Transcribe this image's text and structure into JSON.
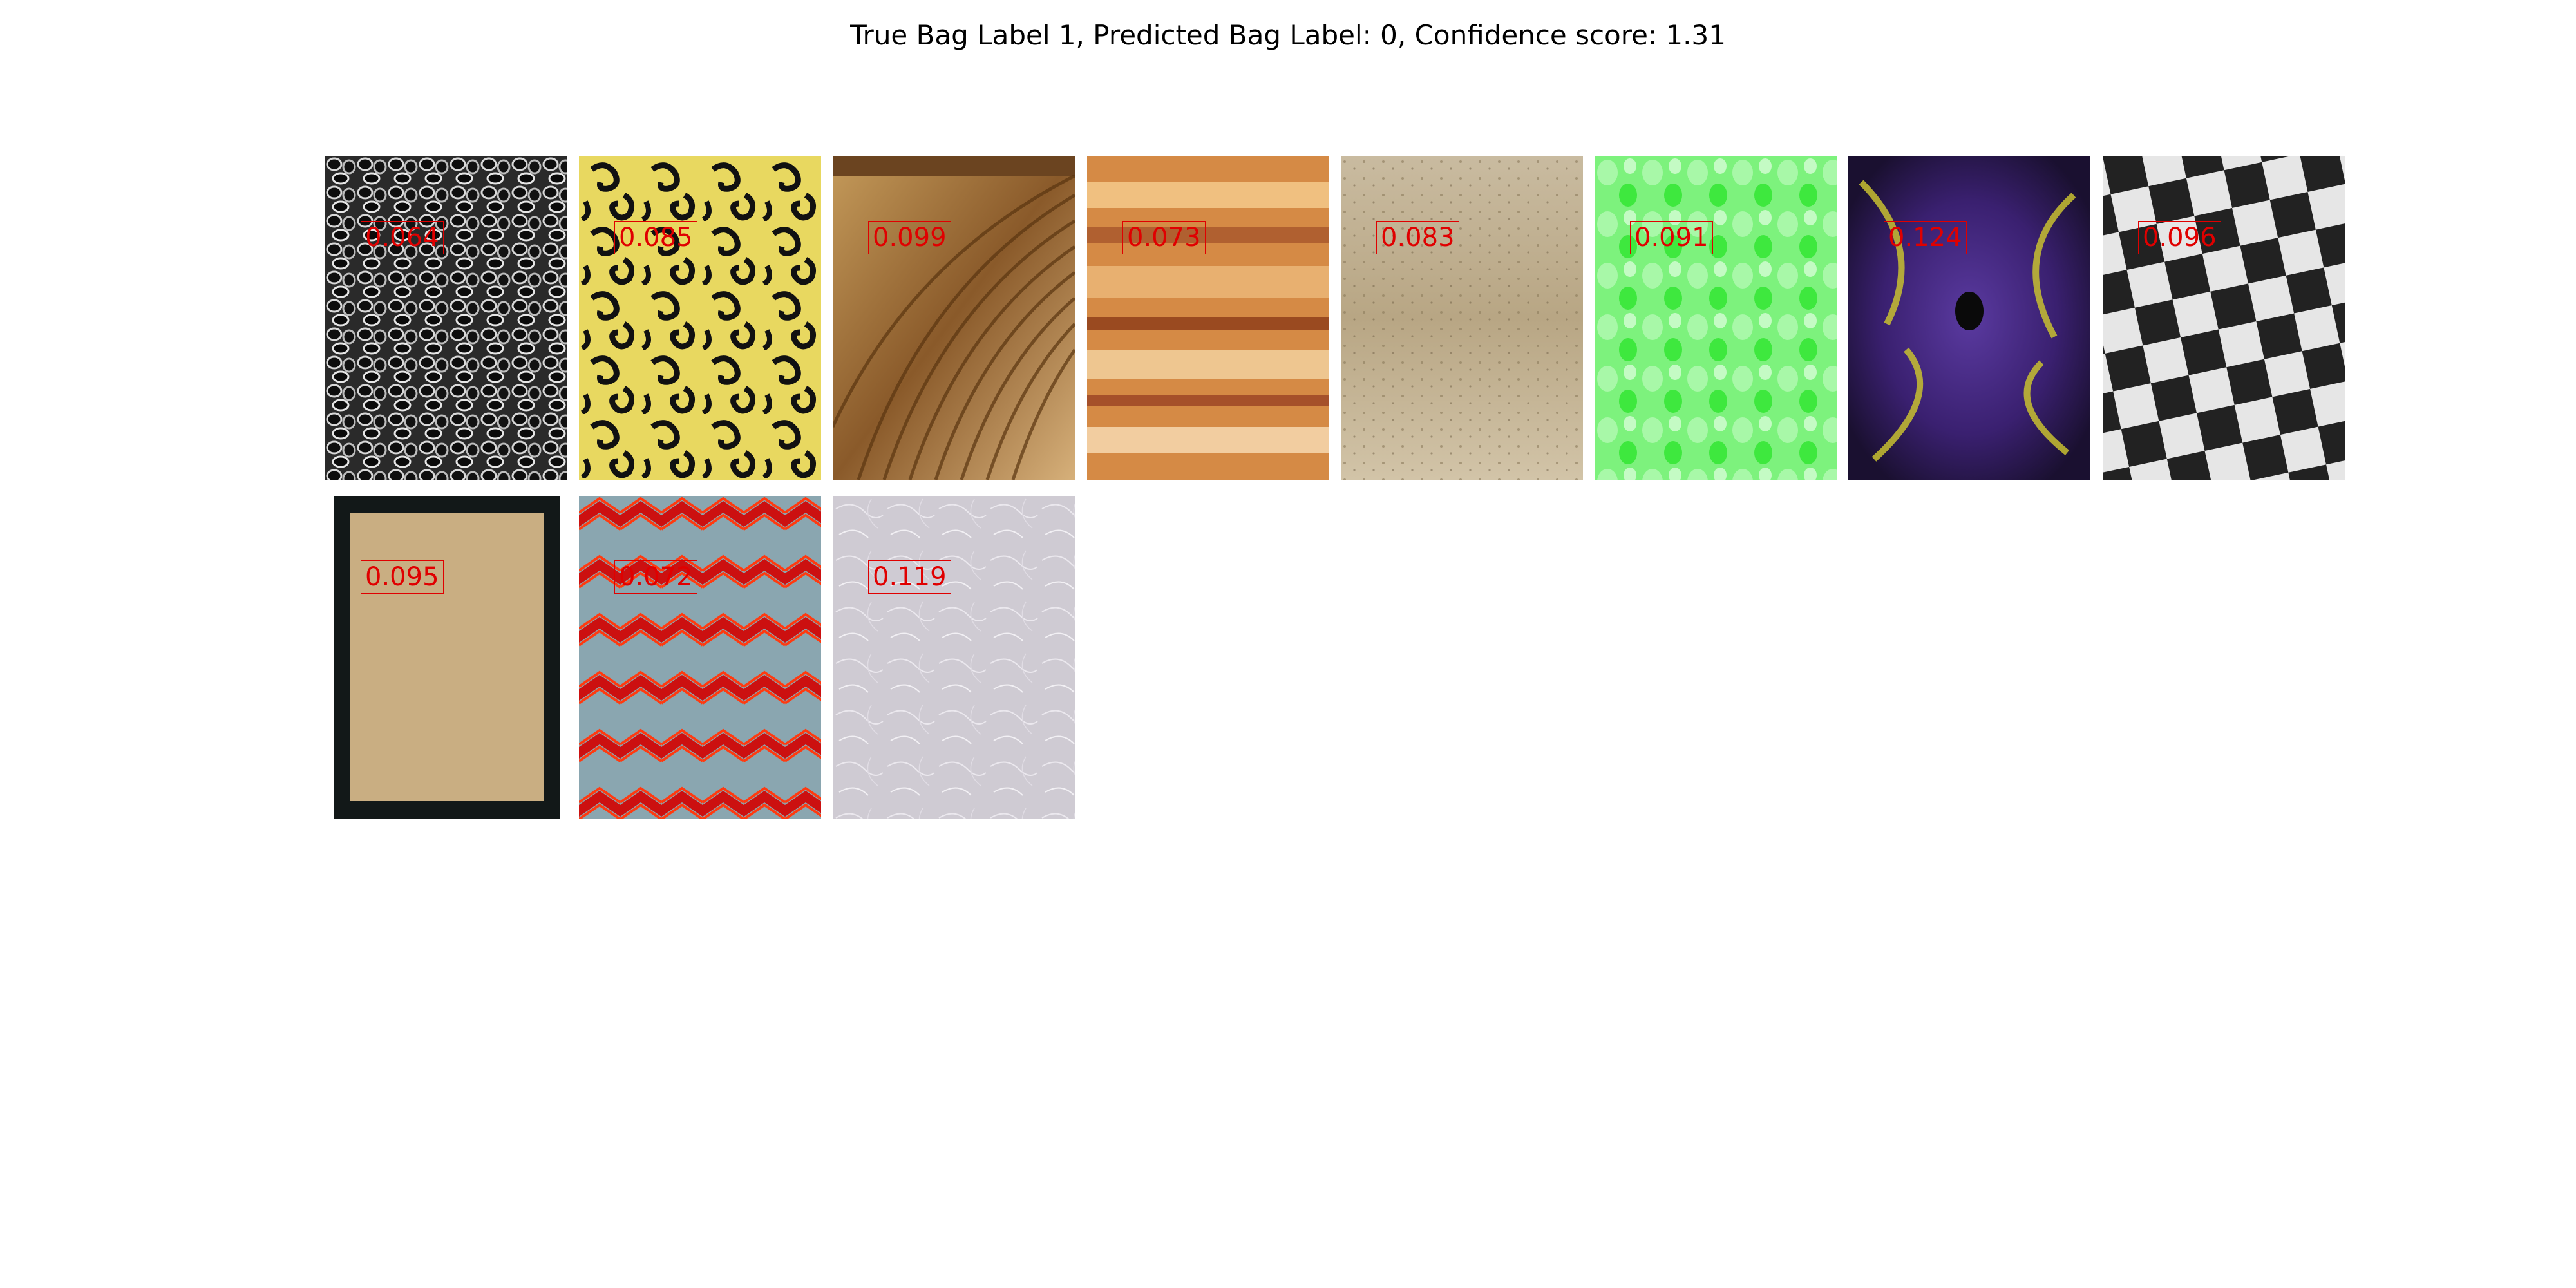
{
  "title": "True Bag Label 1, Predicted Bag Label: 0, Confidence score: 1.31",
  "tiles": [
    {
      "texture": "gray-cellular-mesh",
      "score": "0.064"
    },
    {
      "texture": "yellow-black-swirls",
      "score": "0.085"
    },
    {
      "texture": "brown-wood-grain",
      "score": "0.099"
    },
    {
      "texture": "orange-layered-rock",
      "score": "0.073"
    },
    {
      "texture": "beige-sandstone",
      "score": "0.083"
    },
    {
      "texture": "light-green-mottled",
      "score": "0.091"
    },
    {
      "texture": "purple-fractal",
      "score": "0.124"
    },
    {
      "texture": "black-white-checkerboard",
      "score": "0.096"
    },
    {
      "texture": "tan-paper-on-black",
      "score": "0.095"
    },
    {
      "texture": "red-zigzag-on-blue-gray",
      "score": "0.072"
    },
    {
      "texture": "pale-gray-fibers",
      "score": "0.119"
    }
  ]
}
